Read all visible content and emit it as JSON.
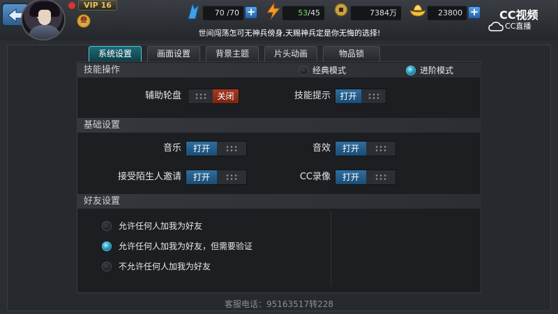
{
  "header": {
    "vip_label": "VIP 16",
    "level_glyph": "叁",
    "stamina": "70 /70",
    "energy_current": "53",
    "energy_rest": "/45",
    "coins": "7384万",
    "gold": "23800",
    "plus": "+",
    "banner": "世间闯荡怎可无神兵傍身,天赐神兵定是你无悔的选择!"
  },
  "watermark": {
    "line1": "CC视频",
    "line2": "CC直播"
  },
  "tabs": [
    {
      "label": "系统设置",
      "active": true
    },
    {
      "label": "画面设置",
      "active": false
    },
    {
      "label": "背景主题",
      "active": false
    },
    {
      "label": "片头动画",
      "active": false
    },
    {
      "label": "物品锁",
      "active": false
    }
  ],
  "sections": {
    "skill": {
      "title": "技能操作",
      "mode_classic": "经典模式",
      "mode_advanced": "进阶模式",
      "aux_wheel_label": "辅助轮盘",
      "aux_wheel_state": "关闭",
      "skill_hint_label": "技能提示",
      "skill_hint_state": "打开"
    },
    "basic": {
      "title": "基础设置",
      "music_label": "音乐",
      "music_state": "打开",
      "sfx_label": "音效",
      "sfx_state": "打开",
      "stranger_label": "接受陌生人邀请",
      "stranger_state": "打开",
      "cc_record_label": "CC录像",
      "cc_record_state": "打开"
    },
    "friend": {
      "title": "好友设置",
      "options": [
        {
          "label": "允许任何人加我为好友",
          "checked": false
        },
        {
          "label": "允许任何人加我为好友，但需要验证",
          "checked": true
        },
        {
          "label": "不允许任何人加我为好友",
          "checked": false
        }
      ]
    }
  },
  "footer": {
    "service": "客服电话：95163517转228"
  },
  "colors": {
    "accent_on": "#2e6f9f",
    "accent_off": "#a8391f",
    "tab_active": "#1c6b78"
  }
}
